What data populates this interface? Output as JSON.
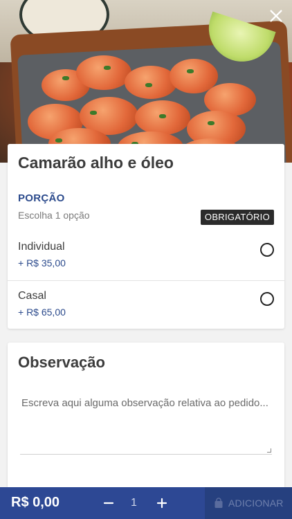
{
  "product": {
    "name": "Camarão alho e óleo"
  },
  "option_group": {
    "title": "PORÇÃO",
    "subtitle": "Escolha 1 opção",
    "required_badge": "OBRIGATÓRIO",
    "options": [
      {
        "label": "Individual",
        "price": "+ R$ 35,00",
        "selected": false
      },
      {
        "label": "Casal",
        "price": "+ R$ 65,00",
        "selected": false
      }
    ]
  },
  "observation": {
    "title": "Observação",
    "placeholder": "Escreva aqui alguma observação relativa ao pedido..."
  },
  "footer": {
    "total": "R$ 0,00",
    "quantity": "1",
    "add_label": "ADICIONAR"
  },
  "icons": {
    "close": "close-icon",
    "minus": "minus-icon",
    "plus": "plus-icon",
    "bag": "shopping-bag-icon"
  },
  "colors": {
    "accent": "#2b4a8c",
    "footer_bg": "#2d4894",
    "badge_bg": "#2b2b2b"
  }
}
